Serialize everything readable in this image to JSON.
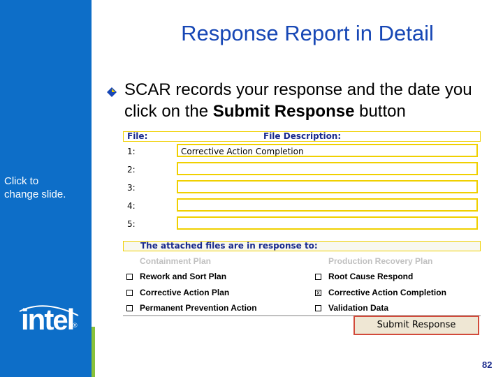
{
  "slide": {
    "title": "Response Report in Detail",
    "sidebar_text": "Click to change slide.",
    "logo_text": "int",
    "logo_e": "e",
    "logo_l": "l",
    "logo_reg": "®",
    "bullet_part1": "SCAR records your response and the date you click on the ",
    "bullet_bold": "Submit Response",
    "bullet_part2": " button",
    "page_number": "82"
  },
  "colors": {
    "sidebar": "#0d6ec8",
    "title": "#1747b5",
    "accent_green": "#89c23a",
    "field_border": "#f0d000",
    "submit_border": "#d24a3a"
  },
  "files": {
    "header_file": "File:",
    "header_description": "File Description:",
    "rows": [
      {
        "num": "1:",
        "value": "Corrective Action Completion"
      },
      {
        "num": "2:",
        "value": ""
      },
      {
        "num": "3:",
        "value": ""
      },
      {
        "num": "4:",
        "value": ""
      },
      {
        "num": "5:",
        "value": ""
      }
    ]
  },
  "attached": {
    "header": "The attached files are in response to:",
    "options": [
      {
        "label": "Containment Plan",
        "enabled": false,
        "checked": false
      },
      {
        "label": "Production Recovery Plan",
        "enabled": false,
        "checked": false
      },
      {
        "label": "Rework and Sort Plan",
        "enabled": true,
        "checked": false
      },
      {
        "label": "Root Cause Respond",
        "enabled": true,
        "checked": false
      },
      {
        "label": "Corrective Action Plan",
        "enabled": true,
        "checked": false
      },
      {
        "label": "Corrective Action Completion",
        "enabled": true,
        "checked": true
      },
      {
        "label": "Permanent Prevention Action",
        "enabled": true,
        "checked": false
      },
      {
        "label": "Validation Data",
        "enabled": true,
        "checked": false
      }
    ],
    "check_mark": "x"
  },
  "submit_label": "Submit Response"
}
